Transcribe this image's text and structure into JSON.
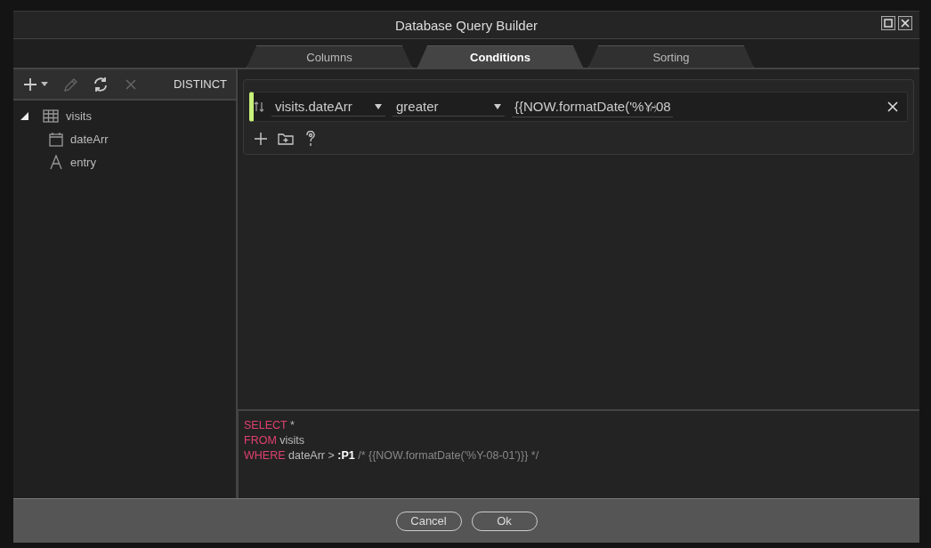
{
  "window": {
    "title": "Database Query Builder"
  },
  "tabs": [
    {
      "label": "Columns",
      "selected": false
    },
    {
      "label": "Conditions",
      "selected": true
    },
    {
      "label": "Sorting",
      "selected": false
    }
  ],
  "toolbar": {
    "tools": [
      {
        "kind": "add",
        "disabled": false
      },
      {
        "kind": "edit",
        "disabled": true
      },
      {
        "kind": "refresh",
        "disabled": false
      },
      {
        "kind": "delete",
        "disabled": true
      }
    ],
    "distinct": "DISTINCT"
  },
  "tree": [
    {
      "label": "visits",
      "kind": "table",
      "expanded": true,
      "children": [
        {
          "label": "dateArr",
          "kind": "date"
        },
        {
          "label": "entry",
          "kind": "text"
        }
      ]
    }
  ],
  "conditions": [
    {
      "field": "visits.dateArr",
      "operator": "greater",
      "value": "{{NOW.formatDate('%Y-08"
    }
  ],
  "sql": [
    [
      {
        "kind": "keyword",
        "text": "SELECT"
      },
      {
        "kind": "plain",
        "text": " *"
      }
    ],
    [
      {
        "kind": "keyword",
        "text": "FROM"
      },
      {
        "kind": "plain",
        "text": " visits"
      }
    ],
    [
      {
        "kind": "keyword",
        "text": "WHERE"
      },
      {
        "kind": "plain",
        "text": " dateArr > "
      },
      {
        "kind": "param",
        "text": ":P1"
      },
      {
        "kind": "comment",
        "text": " /* {{NOW.formatDate('%Y-08-01')}} */"
      }
    ]
  ],
  "buttons": [
    {
      "label": "Cancel"
    },
    {
      "label": "Ok"
    }
  ]
}
